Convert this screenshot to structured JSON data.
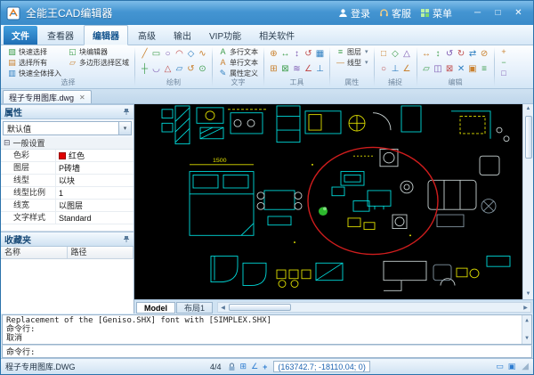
{
  "titlebar": {
    "title": "全能王CAD编辑器",
    "login": "登录",
    "service": "客服",
    "menu": "菜单",
    "window": {
      "min": "─",
      "max": "□",
      "close": "✕"
    }
  },
  "tabs": [
    "文件",
    "查看器",
    "编辑器",
    "高级",
    "输出",
    "VIP功能",
    "相关软件"
  ],
  "ribbon": {
    "select_group": {
      "label": "选择",
      "col1": [
        {
          "icon": "▧",
          "label": "快速选择"
        },
        {
          "icon": "▤",
          "label": "选择所有"
        },
        {
          "icon": "▥",
          "label": "快速全体择入"
        }
      ],
      "col2": [
        {
          "icon": "◱",
          "label": "块编辑器"
        },
        {
          "icon": "▱",
          "label": "多边形选择区域"
        }
      ]
    },
    "draw_group": {
      "label": "绘制",
      "icons": [
        "╱",
        "▭",
        "○",
        "◠",
        "◇",
        "∿",
        "┼",
        "◡",
        "△",
        "▱",
        "↺",
        "⊙"
      ]
    },
    "text_group": {
      "label": "文字",
      "buttons": [
        {
          "icon": "A",
          "label": "多行文本"
        },
        {
          "icon": "A",
          "label": "单行文本"
        },
        {
          "icon": "✎",
          "label": "属性定义"
        }
      ]
    },
    "tools_group": {
      "label": "工具",
      "icons": [
        "⊕",
        "↔",
        "↕",
        "↺",
        "▦",
        "⊞",
        "⊠",
        "≋",
        "∠",
        "⊥"
      ]
    },
    "props_group": {
      "label": "属性",
      "buttons": [
        {
          "icon": "≡",
          "label": "图层",
          "caret": "▾"
        },
        {
          "icon": "—",
          "label": "线型",
          "caret": "▾"
        }
      ]
    },
    "snap_group": {
      "label": "捕捉",
      "icons": [
        "□",
        "◇",
        "△",
        "○",
        "⊥",
        "∠"
      ]
    },
    "edit_group": {
      "label": "编辑",
      "icons": [
        "↔",
        "↕",
        "↺",
        "↻",
        "⇄",
        "⊘",
        "▱",
        "◫",
        "⊠",
        "✕",
        "▣",
        "≡"
      ]
    },
    "side_icons": [
      "+",
      "−",
      "□"
    ]
  },
  "doctab": {
    "label": "程子专用图库.dwg"
  },
  "sidebar": {
    "properties": {
      "title": "属性",
      "preset": "默认值",
      "category": "一般设置",
      "rows": [
        {
          "label": "色彩",
          "value": "红色"
        },
        {
          "label": "图层",
          "value": "P砖墙"
        },
        {
          "label": "线型",
          "value": "以块"
        },
        {
          "label": "线型比例",
          "value": "1"
        },
        {
          "label": "线宽",
          "value": "以图层"
        },
        {
          "label": "文字样式",
          "value": "Standard"
        }
      ],
      "swatch_color": "#e00000"
    },
    "favorites": {
      "title": "收藏夹",
      "columns": [
        "名称",
        "路径"
      ]
    }
  },
  "canvas": {
    "model_tabs": [
      "Model",
      "布局1"
    ],
    "dimension_label": "1500",
    "colors": {
      "background": "#000000",
      "cyan": "#00dcdc",
      "yellow": "#e0e000",
      "selection_red": "#cf1d1d",
      "green": "#2db82d"
    }
  },
  "command": {
    "history": [
      "Replacement of the [Geniso.SHX] font with [SIMPLEX.SHX]",
      "命令行:",
      "取消"
    ],
    "prompt": "命令行:"
  },
  "statusbar": {
    "filename": "程子专用图库.DWG",
    "counter": "4/4",
    "coords": "(163742.7; -18110.04; 0)"
  },
  "ui": {
    "caret": "▾",
    "expander": "⊟",
    "close": "✕",
    "up": "▲",
    "down": "▼",
    "left": "◀",
    "right": "▶",
    "grip": "◢",
    "grid": "⊞",
    "angle": "∠",
    "cross": "+",
    "layout": "▭",
    "screen": "▣"
  }
}
